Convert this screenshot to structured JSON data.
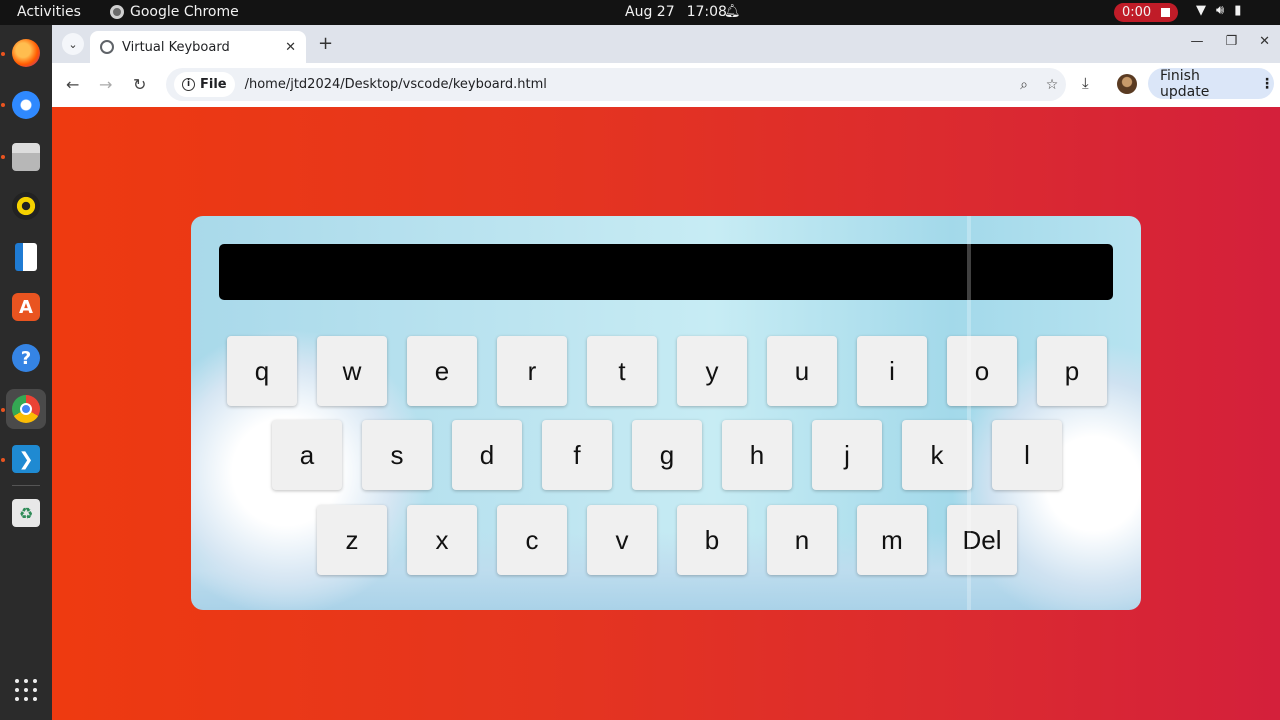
{
  "topbar": {
    "activities": "Activities",
    "app_name": "Google Chrome",
    "date": "Aug 27",
    "time": "17:08",
    "recording_time": "0:00"
  },
  "dock": {
    "apps": [
      "firefox-icon",
      "thunderbird-icon",
      "files-icon",
      "rhythmbox-icon",
      "writer-icon",
      "app-center-icon",
      "help-icon",
      "chrome-icon",
      "vscode-icon",
      "trash-icon"
    ]
  },
  "browser": {
    "tab_title": "Virtual Keyboard",
    "chip_label": "File",
    "url": "/home/jtd2024/Desktop/vscode/keyboard.html",
    "update_label": "Finish update"
  },
  "keyboard": {
    "display_text": "",
    "row1": [
      "q",
      "w",
      "e",
      "r",
      "t",
      "y",
      "u",
      "i",
      "o",
      "p"
    ],
    "row2": [
      "a",
      "s",
      "d",
      "f",
      "g",
      "h",
      "j",
      "k",
      "l"
    ],
    "row3": [
      "z",
      "x",
      "c",
      "v",
      "b",
      "n",
      "m",
      "Del"
    ]
  },
  "colors": {
    "bg_left": "#ee3a10",
    "bg_right": "#d4203b",
    "display_bg": "#000000",
    "key_bg": "#f0f0f0"
  }
}
